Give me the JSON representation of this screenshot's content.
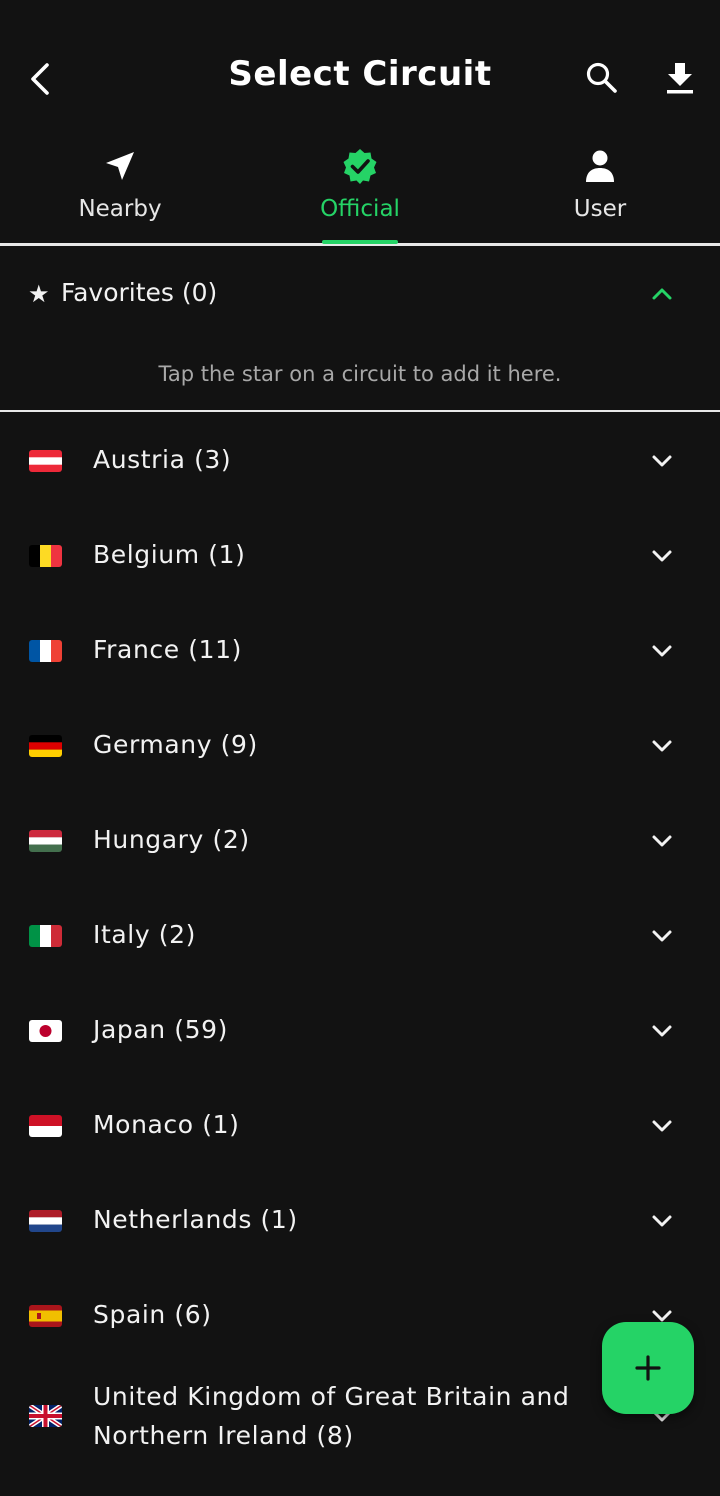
{
  "header": {
    "title": "Select Circuit",
    "back_icon": "chevron-left-icon",
    "search_icon": "search-icon",
    "download_icon": "download-icon"
  },
  "tabs": [
    {
      "label": "Nearby",
      "icon": "navigation-arrow-icon",
      "active": false
    },
    {
      "label": "Official",
      "icon": "verified-badge-icon",
      "active": true
    },
    {
      "label": "User",
      "icon": "person-icon",
      "active": false
    }
  ],
  "favorites": {
    "star": "★",
    "title": "Favorites (0)",
    "hint": "Tap the star on a circuit to add it here.",
    "expanded": true
  },
  "countries": [
    {
      "label": "Austria (3)",
      "flag": "AT"
    },
    {
      "label": "Belgium (1)",
      "flag": "BE"
    },
    {
      "label": "France (11)",
      "flag": "FR"
    },
    {
      "label": "Germany (9)",
      "flag": "DE"
    },
    {
      "label": "Hungary (2)",
      "flag": "HU"
    },
    {
      "label": "Italy (2)",
      "flag": "IT"
    },
    {
      "label": "Japan (59)",
      "flag": "JP"
    },
    {
      "label": "Monaco (1)",
      "flag": "MC"
    },
    {
      "label": "Netherlands (1)",
      "flag": "NL"
    },
    {
      "label": "Spain (6)",
      "flag": "ES"
    },
    {
      "label_line1": "United Kingdom of Great Britain and",
      "label_line2": "Northern Ireland (8)",
      "flag": "GB"
    }
  ],
  "fab": {
    "icon": "plus-icon",
    "label": "+"
  },
  "colors": {
    "accent": "#25d366",
    "background": "#121212",
    "text": "#f2f2f2",
    "muted": "#a8a8a8",
    "divider": "#e8e8e8"
  }
}
